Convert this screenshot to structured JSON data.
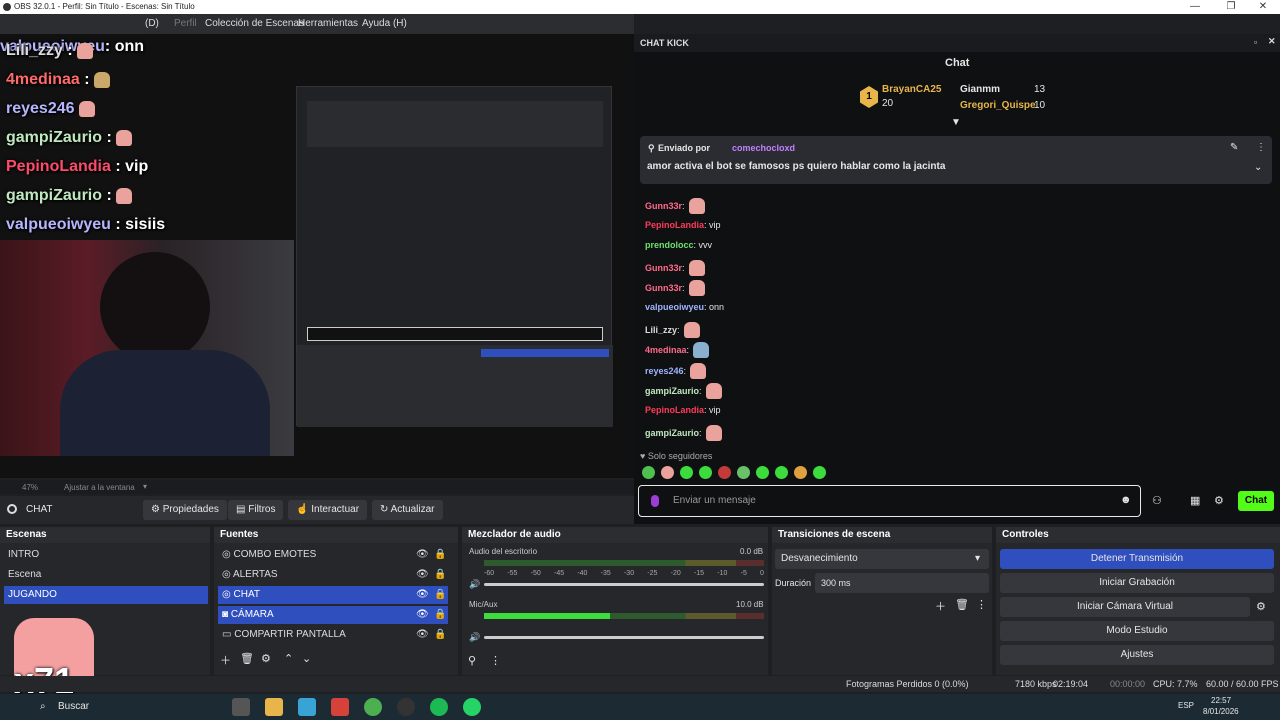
{
  "window": {
    "title": "OBS 32.0.1 - Perfil: Sin Título - Escenas: Sin Título"
  },
  "menu": [
    "(D)",
    "Perfil",
    "Colección de Escenas",
    "Herramientas",
    "Ayuda (H)"
  ],
  "overlay_chat": [
    {
      "user": "valpueoiwyeu",
      "text": ": onn"
    },
    {
      "user": "Lili_zzy",
      "text": " :"
    },
    {
      "user": "4medinaa",
      "text": " :"
    },
    {
      "user": "reyes246",
      "text": ""
    },
    {
      "user": "gampiZaurio",
      "text": " :"
    },
    {
      "user": "PepinoLandia",
      "text": " : vip"
    },
    {
      "user": "gampiZaurio",
      "text": " :"
    },
    {
      "user": "valpueoiwyeu",
      "text": " : sisiis"
    }
  ],
  "preview_bar": {
    "zoom": "47%",
    "fit": "Ajustar a la ventana"
  },
  "source_toolbar": {
    "source": "CHAT",
    "properties": "Propiedades",
    "filters": "Filtros",
    "interact": "Interactuar",
    "refresh": "Actualizar"
  },
  "chat_dock": {
    "title": "CHAT KICK",
    "header": "Chat",
    "leaderboard": {
      "first": "BrayanCA25",
      "first_points": "20",
      "rank": "1",
      "second": "Gianmm",
      "second_points": "13",
      "third": "Gregori_Quispe",
      "third_points": "10"
    },
    "pinned": {
      "label": "Enviado por",
      "user": "comechocloxd",
      "text": "amor activa el bot se famosos ps quiero hablar como la jacinta"
    },
    "messages": [
      {
        "user": "Gunn33r",
        "text": ""
      },
      {
        "user": "Gunn33r",
        "text": ""
      },
      {
        "user": "PepinoLandia",
        "text": " vip"
      },
      {
        "user": "prendolocc",
        "text": " vvv"
      },
      {
        "user": "Gunn33r",
        "text": ""
      },
      {
        "user": "Gunn33r",
        "text": ""
      },
      {
        "user": "valpueoiwyeu",
        "text": " onn"
      },
      {
        "user": "Lili_zzy",
        "text": ""
      },
      {
        "user": "4medinaa",
        "text": ""
      },
      {
        "user": "reyes246",
        "text": ""
      },
      {
        "user": "gampiZaurio",
        "text": ""
      },
      {
        "user": "PepinoLandia",
        "text": " vip"
      },
      {
        "user": "gampiZaurio",
        "text": ""
      }
    ],
    "followers_only": "Solo seguidores",
    "input_placeholder": "Enviar un mensaje",
    "send": "Chat"
  },
  "colors": {
    "accent": "#2f4fbf",
    "kick_green": "#53fc18",
    "meter_green": "#3ddc3d",
    "meter_yellow": "#c9c93a",
    "meter_red": "#c43a3a"
  },
  "scenes": {
    "title": "Escenas",
    "items": [
      "INTRO",
      "Escena",
      "JUGANDO"
    ],
    "selected": 2
  },
  "sources": {
    "title": "Fuentes",
    "items": [
      "COMBO EMOTES",
      "ALERTAS",
      "CHAT",
      "CÁMARA",
      "COMPARTIR PANTALLA"
    ]
  },
  "mixer": {
    "title": "Mezclador de audio",
    "channels": [
      {
        "name": "Audio del escritorio",
        "db": "0.0 dB",
        "level": 0
      },
      {
        "name": "Mic/Aux",
        "db": "10.0 dB",
        "level": 0.45
      }
    ],
    "ticks": [
      "-60",
      "-55",
      "-50",
      "-45",
      "-40",
      "-35",
      "-30",
      "-25",
      "-20",
      "-15",
      "-10",
      "-5",
      "0"
    ]
  },
  "transitions": {
    "title": "Transiciones de escena",
    "type": "Desvanecimiento",
    "duration_label": "Duración",
    "duration": "300 ms"
  },
  "controls": {
    "title": "Controles",
    "buttons": [
      "Detener Transmisión",
      "Iniciar Grabación",
      "Iniciar Cámara Virtual",
      "Modo Estudio",
      "Ajustes"
    ]
  },
  "status": {
    "dropped": "Fotogramas Perdidos 0 (0.0%)",
    "kbps": "7180 kbps",
    "time": "02:19:04",
    "rec": "00:00:00",
    "cpu": "CPU: 7.7%",
    "fps": "60.00 / 60.00 FPS"
  },
  "taskbar": {
    "search": "Buscar",
    "lang": "ESP",
    "time": "22:57",
    "date": "8/01/2026"
  },
  "badge": "x71"
}
